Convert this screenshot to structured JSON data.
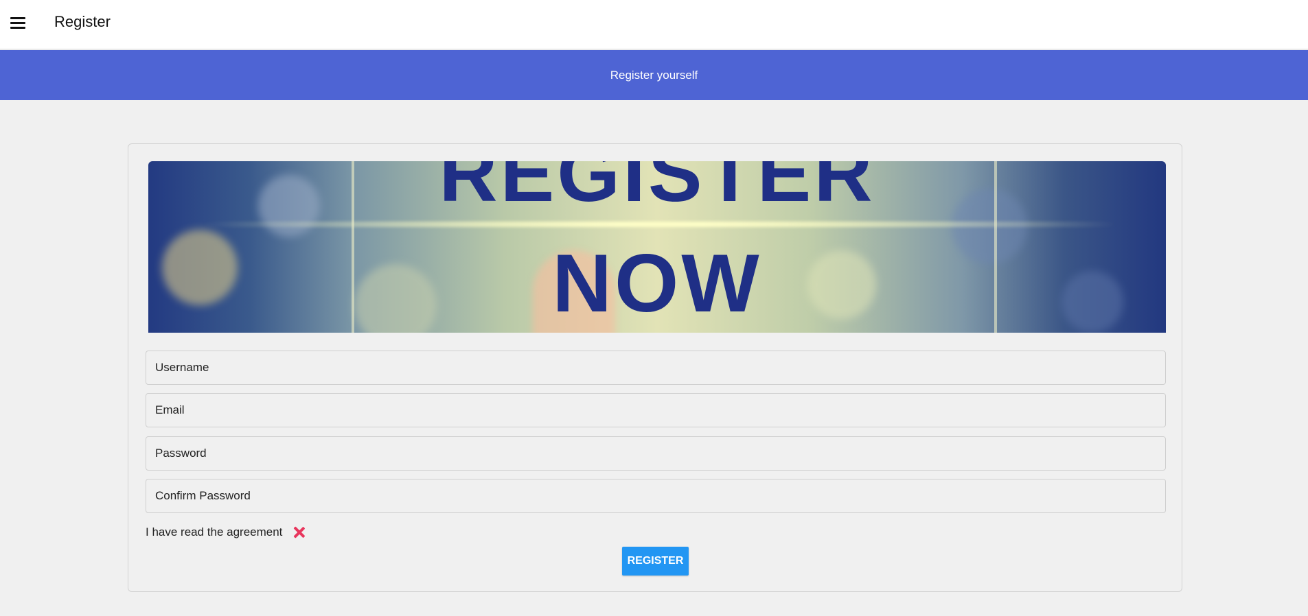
{
  "header": {
    "title": "Register",
    "menu_icon": "hamburger-menu-icon"
  },
  "banner": {
    "text": "Register yourself"
  },
  "hero": {
    "line1": "REGISTER",
    "line2": "NOW"
  },
  "form": {
    "username_placeholder": "Username",
    "email_placeholder": "Email",
    "password_placeholder": "Password",
    "confirm_password_placeholder": "Confirm Password",
    "agreement_label": "I have read the agreement",
    "agreement_icon": "close-x-icon",
    "submit_label": "REGISTER"
  },
  "colors": {
    "banner": "#4e64d4",
    "button": "#2296f3",
    "agreement_x": "#e8365d",
    "hero_text": "#1f2f86"
  }
}
